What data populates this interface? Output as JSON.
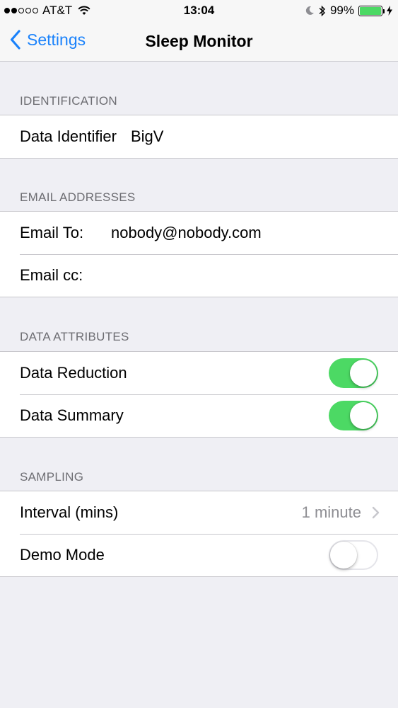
{
  "status_bar": {
    "carrier": "AT&T",
    "time": "13:04",
    "battery_percent": "99%",
    "battery_level": 0.99,
    "signal_bars": [
      true,
      true,
      false,
      false,
      false
    ]
  },
  "nav": {
    "back_label": "Settings",
    "title": "Sleep Monitor"
  },
  "sections": {
    "identification": {
      "header": "IDENTIFICATION",
      "data_identifier_label": "Data Identifier",
      "data_identifier_value": "BigV"
    },
    "email": {
      "header": "EMAIL ADDRESSES",
      "to_label": "Email To:",
      "to_value": "nobody@nobody.com",
      "cc_label": "Email cc:",
      "cc_value": ""
    },
    "attributes": {
      "header": "DATA ATTRIBUTES",
      "reduction_label": "Data Reduction",
      "reduction_on": true,
      "summary_label": "Data Summary",
      "summary_on": true
    },
    "sampling": {
      "header": "SAMPLING",
      "interval_label": "Interval (mins)",
      "interval_value": "1 minute",
      "demo_label": "Demo Mode",
      "demo_on": false
    }
  },
  "colors": {
    "accent": "#1a82fb",
    "toggle_on": "#4cd964",
    "background": "#efeff4"
  }
}
